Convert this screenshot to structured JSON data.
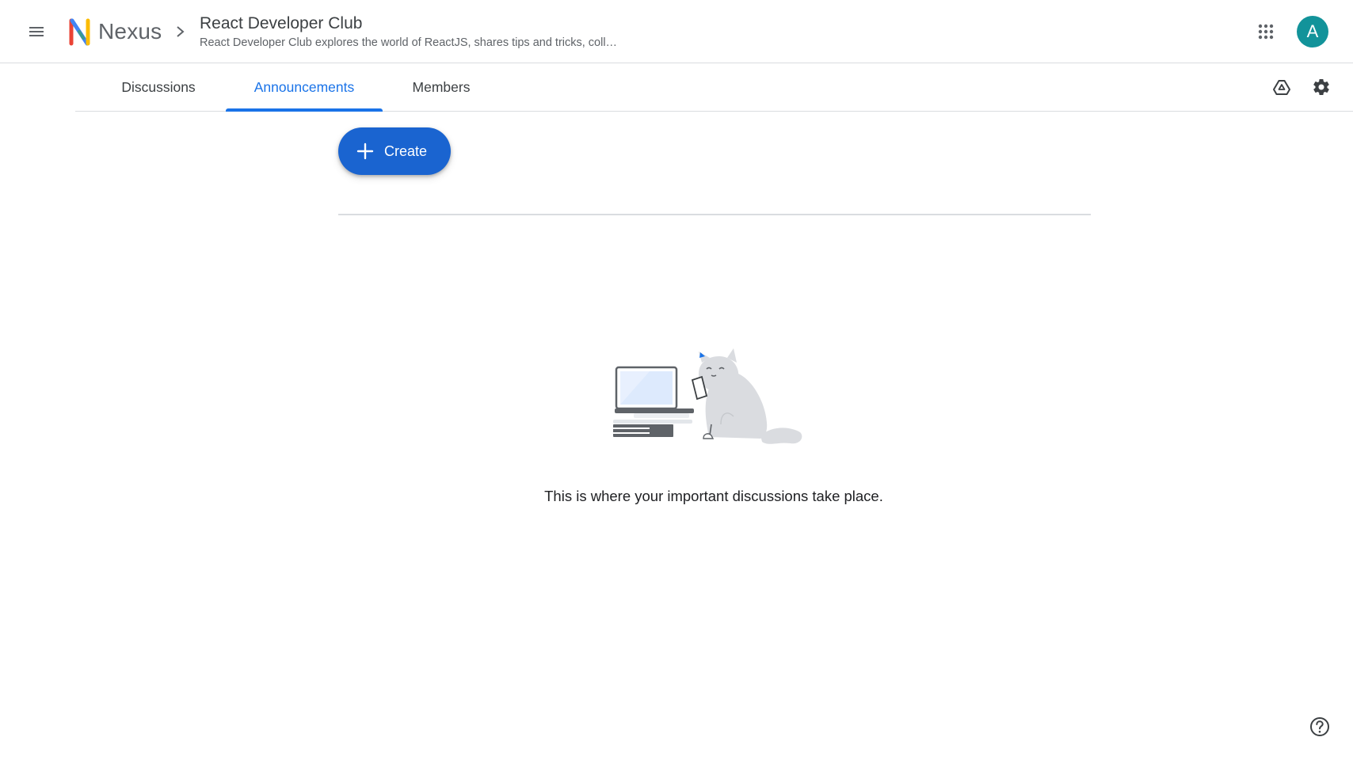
{
  "header": {
    "app_name": "Nexus",
    "group_title": "React Developer Club",
    "group_description": "React Developer Club explores the world of ReactJS, shares tips and tricks, coll…",
    "avatar_letter": "A"
  },
  "tabs": [
    {
      "label": "Discussions",
      "active": false
    },
    {
      "label": "Announcements",
      "active": true
    },
    {
      "label": "Members",
      "active": false
    }
  ],
  "actions": {
    "create_label": "Create"
  },
  "empty_state": {
    "message": "This is where your important discussions take place."
  },
  "icons": [
    "hamburger-menu-icon",
    "nexus-logo-icon",
    "chevron-right-icon",
    "apps-grid-icon",
    "drive-icon",
    "gear-icon",
    "plus-icon",
    "help-icon"
  ],
  "colors": {
    "accent": "#1a73e8",
    "create_button": "#1a64d0",
    "avatar": "#12939a",
    "divider": "#dadce0"
  }
}
